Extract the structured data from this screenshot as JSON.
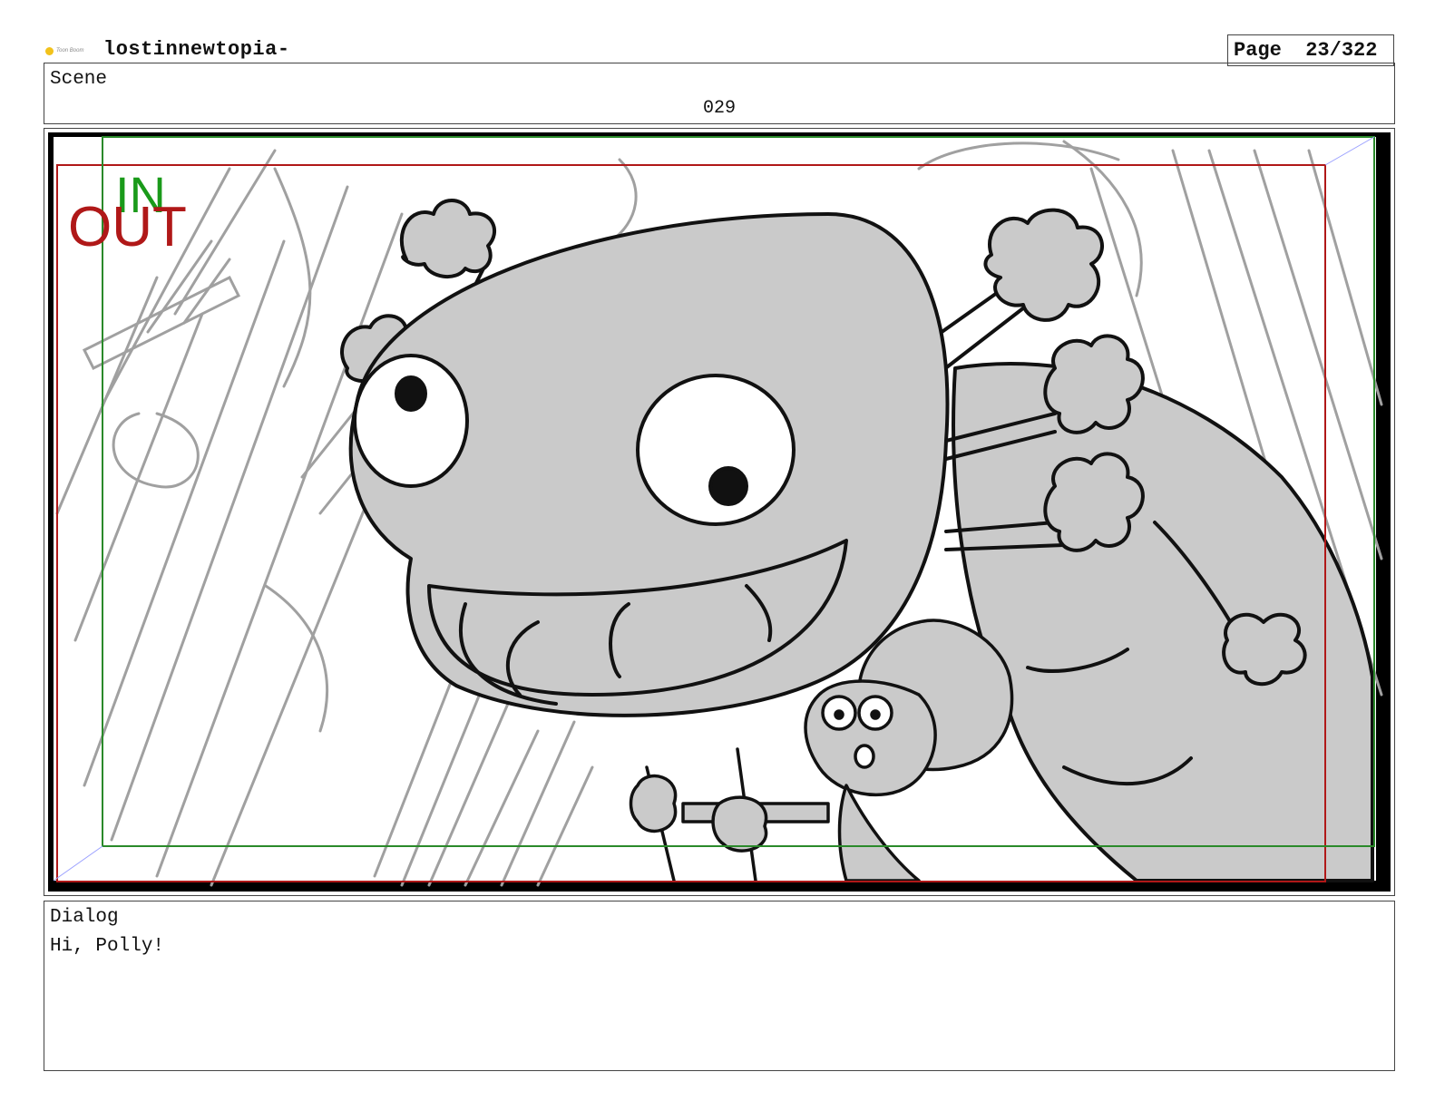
{
  "header": {
    "logo_text": "Toon Boom",
    "project_title": "lostinnewtopia-",
    "page_label": "Page  23/322"
  },
  "scene": {
    "label": "Scene",
    "number": "029"
  },
  "panel": {
    "in_marker": "IN",
    "out_marker": "OUT",
    "colors": {
      "in_frame": "#2a8a2a",
      "out_frame": "#b01818",
      "character_fill": "#cacaca",
      "background_lines": "#a0a0a0",
      "ink": "#111111"
    }
  },
  "dialog": {
    "label": "Dialog",
    "text": "Hi, Polly!"
  }
}
